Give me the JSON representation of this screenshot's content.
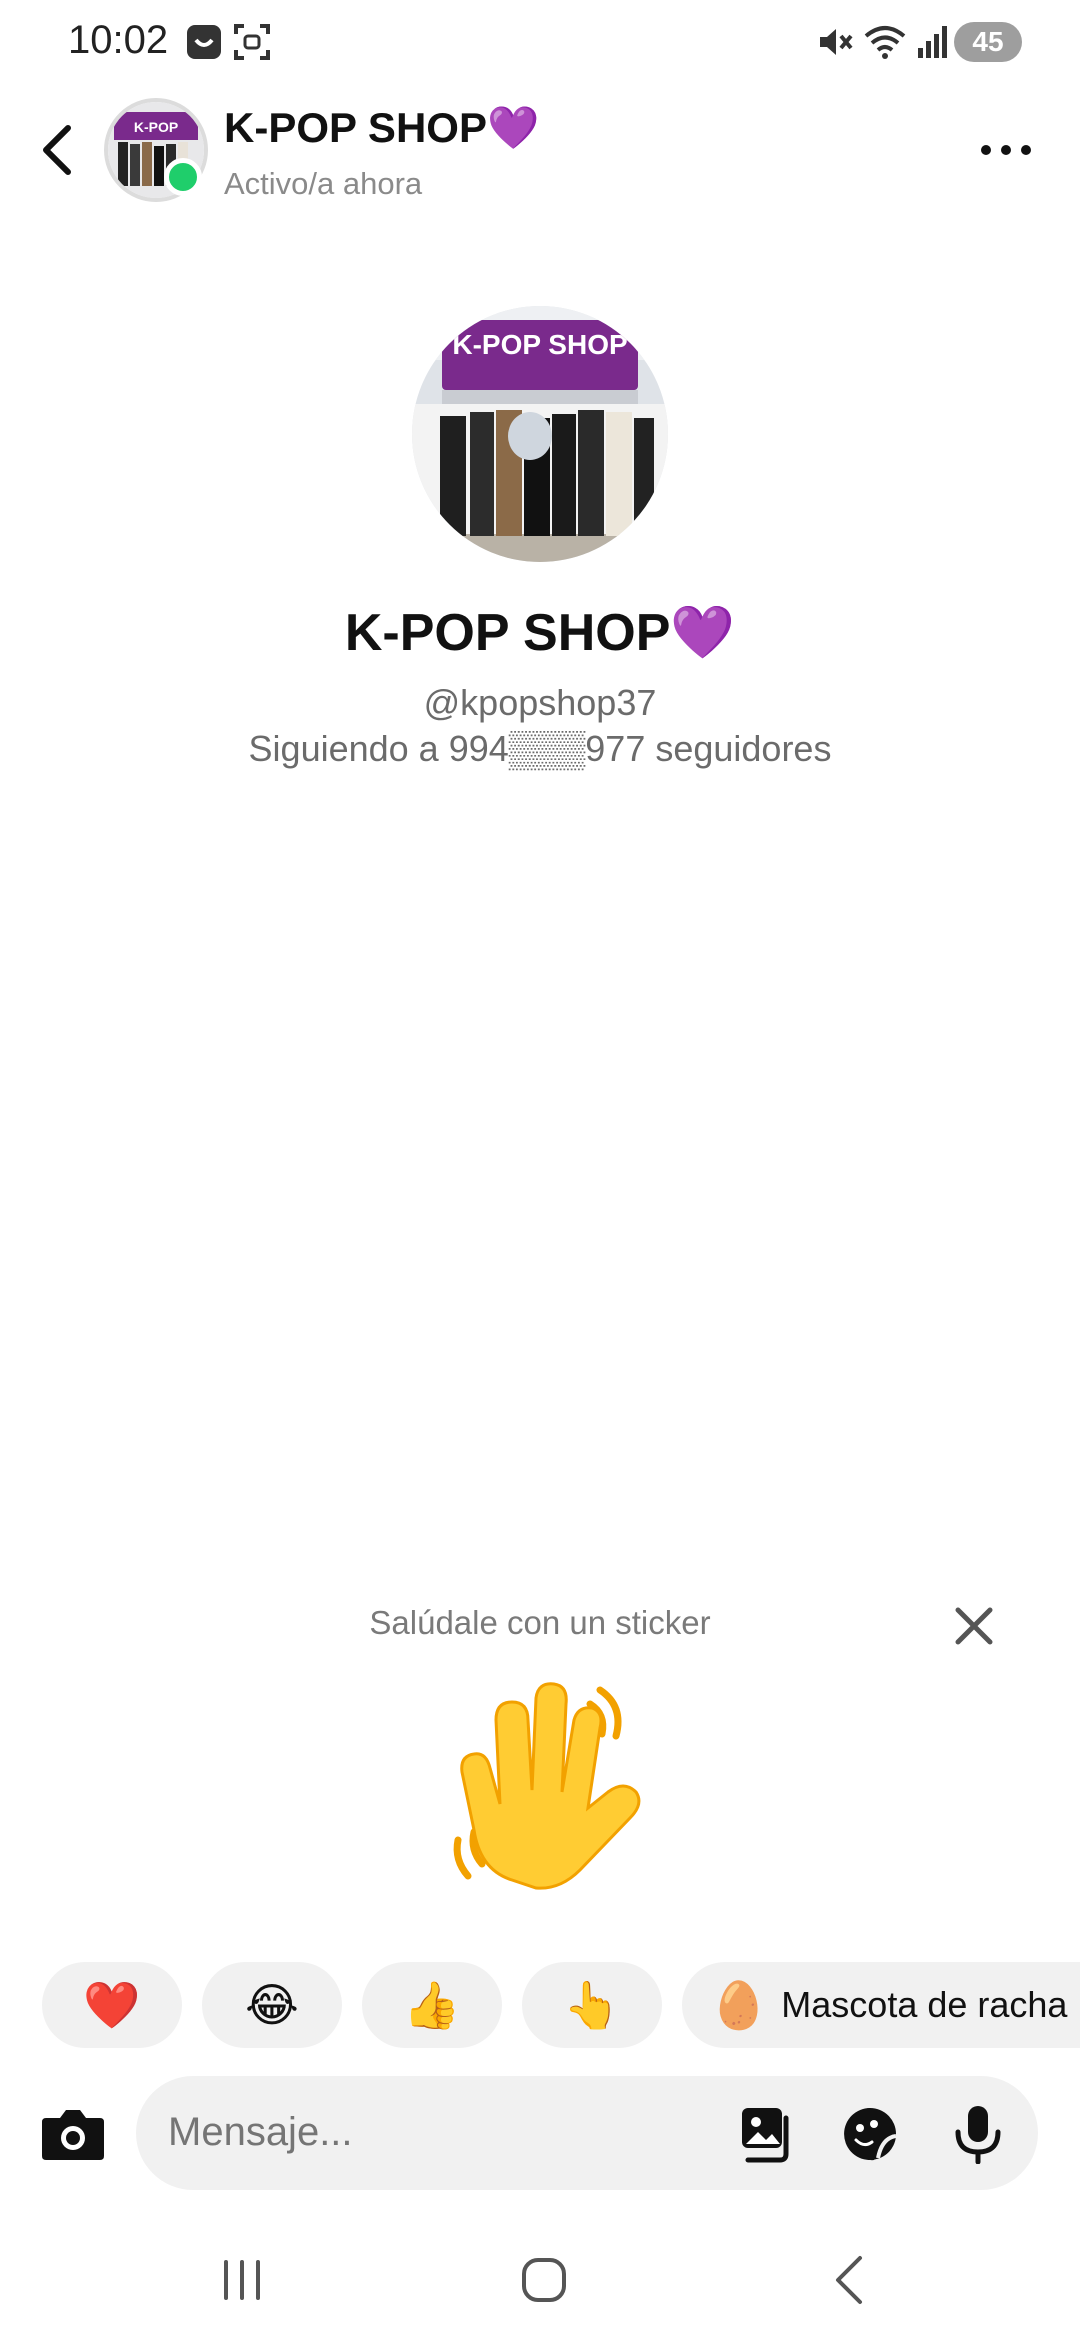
{
  "status_bar": {
    "time": "10:02",
    "battery": "45",
    "icons": [
      "app-icon",
      "screenshot-icon",
      "mute-icon",
      "wifi-icon",
      "signal-icon",
      "battery-icon"
    ]
  },
  "header": {
    "name": "K-POP SHOP💜",
    "status": "Activo/a ahora",
    "online_color": "#1fce6b"
  },
  "profile": {
    "name": "K-POP SHOP💜",
    "handle": "@kpopshop37",
    "stats": "Siguiendo a 994▒▒▒977 seguidores",
    "avatar_sign_text": "K-POP SHOP"
  },
  "sticker_prompt": {
    "text": "Salúdale con un sticker",
    "sticker": "waving-hand"
  },
  "quick_reactions": [
    {
      "emoji": "❤️",
      "name": "heart"
    },
    {
      "emoji": "😂",
      "name": "laughing"
    },
    {
      "emoji": "👍",
      "name": "thumbs-up"
    },
    {
      "emoji": "👆",
      "name": "pointing"
    },
    {
      "emoji": "🥚",
      "name": "streak-pet",
      "label": "Mascota de racha"
    }
  ],
  "composer": {
    "placeholder": "Mensaje..."
  },
  "colors": {
    "accent_online": "#1fce6b",
    "chip_bg": "#f1f1f1",
    "text_secondary": "#7a7a7a",
    "brand_purple": "#7a2a8c"
  }
}
